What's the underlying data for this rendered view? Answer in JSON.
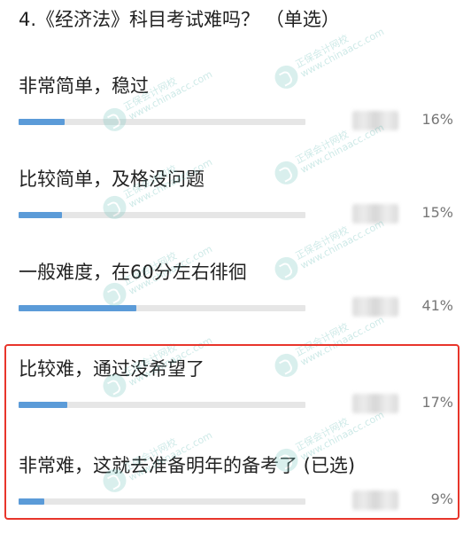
{
  "question": {
    "title": "4.《经济法》科目考试难吗？ （单选）"
  },
  "options": [
    {
      "label": "非常简单，稳过",
      "percent_text": "16%",
      "percent": 16
    },
    {
      "label": "比较简单，及格没问题",
      "percent_text": "15%",
      "percent": 15
    },
    {
      "label": "一般难度，在60分左右徘徊",
      "percent_text": "41%",
      "percent": 41
    },
    {
      "label": "比较难，通过没希望了",
      "percent_text": "17%",
      "percent": 17
    },
    {
      "label": "非常难，这就去准备明年的备考了 (已选)",
      "percent_text": "9%",
      "percent": 9
    }
  ],
  "watermark": {
    "line1": "正保会计网校",
    "line2": "www.chinaacc.com"
  },
  "colors": {
    "bar_fill": "#5b9bd8",
    "bar_track": "#e6e6e6",
    "highlight": "#e8352b",
    "watermark": "#79c9c2"
  }
}
